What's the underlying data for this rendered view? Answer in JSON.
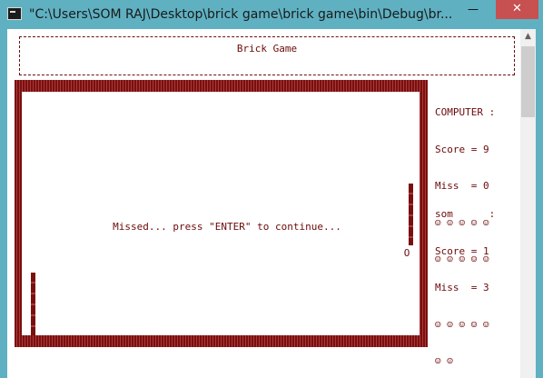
{
  "window": {
    "title": "\"C:\\Users\\SOM RAJ\\Desktop\\brick game\\brick game\\bin\\Debug\\br...",
    "minimize_glyph": "—",
    "maximize_glyph": "☐",
    "close_glyph": "✕"
  },
  "header": {
    "title": "Brick Game"
  },
  "game": {
    "ball_glyph": "O",
    "message": "Missed... press \"ENTER\" to continue..."
  },
  "computer": {
    "name_line": "COMPUTER :",
    "score_line": "Score = 9",
    "miss_line": "Miss  = 0",
    "lives_line_1": "☺ ☺ ☺ ☺ ☺",
    "lives_line_2": "☺ ☺ ☺ ☺ ☺"
  },
  "player": {
    "name_line": "som      :",
    "score_line": "Score = 1",
    "miss_line": "Miss  = 3",
    "lives_line_1": "☺ ☺ ☺ ☺ ☺",
    "lives_line_2": "☺ ☺"
  },
  "colors": {
    "text": "#6b0a0a",
    "brick": "#7a0f0f",
    "titlebar": "#5fb1c2",
    "close_button": "#c75050"
  },
  "icons": {
    "app": "console-icon",
    "scroll_up": "arrow-up-icon"
  }
}
